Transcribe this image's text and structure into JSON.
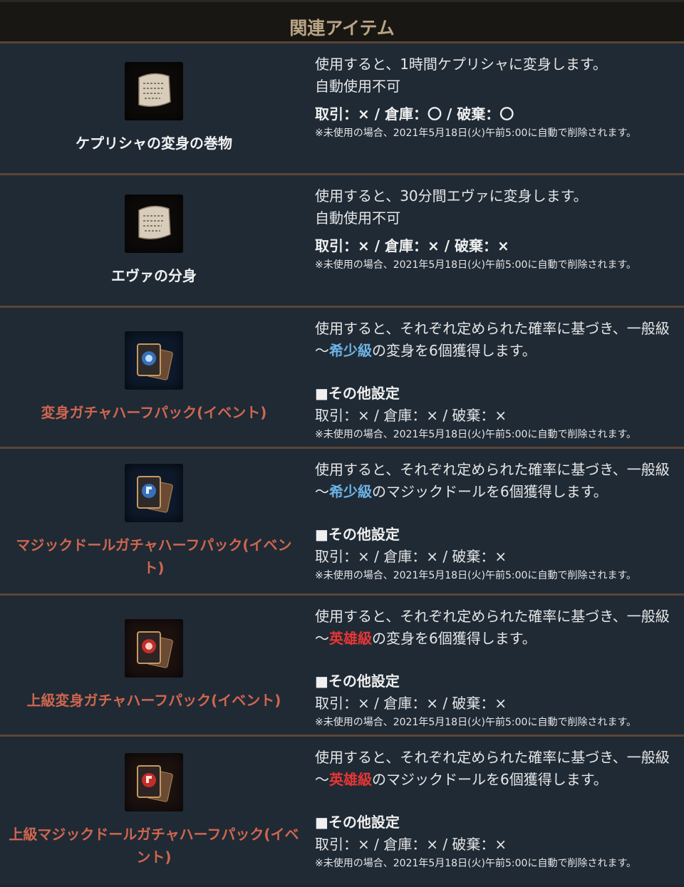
{
  "header": {
    "title": "関連アイテム"
  },
  "colors": {
    "rare": "#6db2e3",
    "hero": "#e83535",
    "event_name": "#d0664e",
    "border": "#5a4536"
  },
  "items": [
    {
      "name": "ケプリシャの変身の巻物",
      "icon": "scroll-icon",
      "desc1": "使用すると、1時間ケプリシャに変身します。",
      "desc2": "自動使用不可",
      "trade": "取引：× / 倉庫：〇 / 破棄：〇",
      "note": "※未使用の場合、2021年5月18日(火)午前5:00に自動で削除されます。"
    },
    {
      "name": "エヴァの分身",
      "icon": "scroll-icon",
      "desc1": "使用すると、30分間エヴァに変身します。",
      "desc2": "自動使用不可",
      "trade": "取引：× / 倉庫：× / 破棄：×",
      "note": "※未使用の場合、2021年5月18日(火)午前5:00に自動で削除されます。"
    },
    {
      "name": "変身ガチャハーフパック(イベント)",
      "icon": "blue-card-pack-icon",
      "desc_pre": "使用すると、それぞれ定められた確率に基づき、一般級～",
      "desc_grade": "希少級",
      "desc_post": "の変身を6個獲得します。",
      "settings_title": "■その他設定",
      "trade": "取引：× / 倉庫：× / 破棄：×",
      "note": "※未使用の場合、2021年5月18日(火)午前5:00に自動で削除されます。"
    },
    {
      "name": "マジックドールガチャハーフパック(イベント)",
      "icon": "blue-doll-card-pack-icon",
      "desc_pre": "使用すると、それぞれ定められた確率に基づき、一般級～",
      "desc_grade": "希少級",
      "desc_post": "のマジックドールを6個獲得します。",
      "settings_title": "■その他設定",
      "trade": "取引：× / 倉庫：× / 破棄：×",
      "note": "※未使用の場合、2021年5月18日(火)午前5:00に自動で削除されます。"
    },
    {
      "name": "上級変身ガチャハーフパック(イベント)",
      "icon": "red-card-pack-icon",
      "desc_pre": "使用すると、それぞれ定められた確率に基づき、一般級～",
      "desc_grade": "英雄級",
      "desc_post": "の変身を6個獲得します。",
      "settings_title": "■その他設定",
      "trade": "取引：× / 倉庫：× / 破棄：×",
      "note": "※未使用の場合、2021年5月18日(火)午前5:00に自動で削除されます。"
    },
    {
      "name": "上級マジックドールガチャハーフパック(イベント)",
      "icon": "red-doll-card-pack-icon",
      "desc_pre": "使用すると、それぞれ定められた確率に基づき、一般級～",
      "desc_grade": "英雄級",
      "desc_post": "のマジックドールを6個獲得します。",
      "settings_title": "■その他設定",
      "trade": "取引：× / 倉庫：× / 破棄：×",
      "note": "※未使用の場合、2021年5月18日(火)午前5:00に自動で削除されます。"
    }
  ]
}
